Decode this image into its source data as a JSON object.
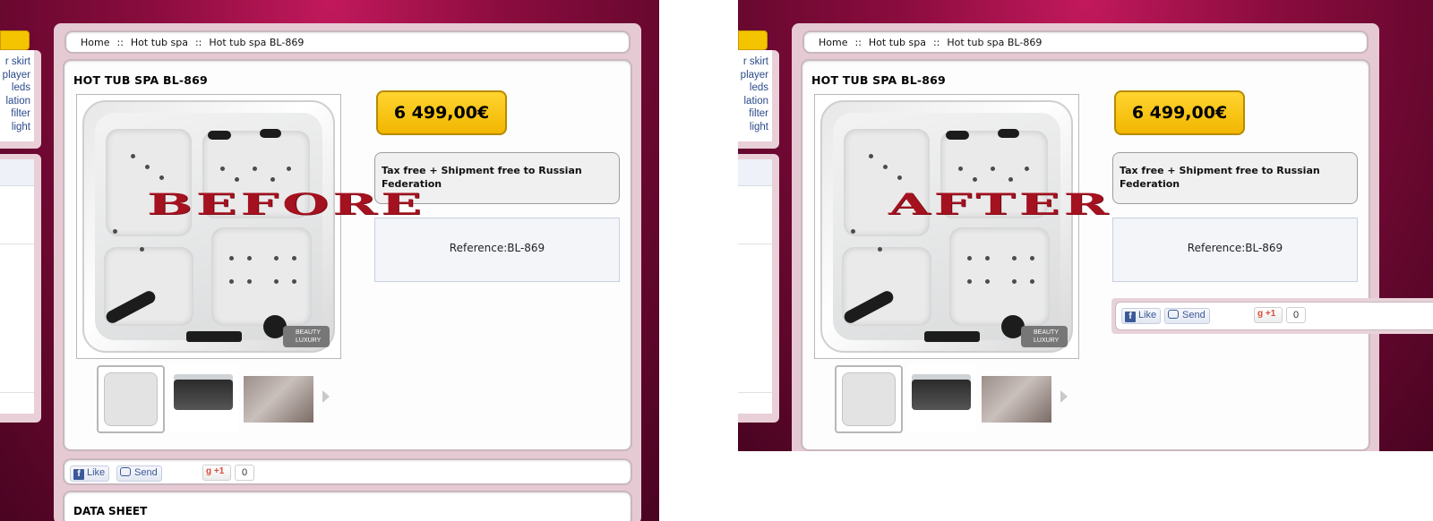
{
  "breadcrumb": {
    "home": "Home",
    "separator": "::",
    "category": "Hot tub spa",
    "current": "Hot tub spa BL-869"
  },
  "sidebar": {
    "links": [
      "r skirt",
      "player",
      "leds",
      "lation",
      "filter",
      "light"
    ]
  },
  "product": {
    "title": "HOT TUB SPA BL-869",
    "price": "6 499,00€",
    "tax_note": "Tax free + Shipment free to Russian Federation",
    "reference": "Reference:BL-869",
    "brand_badge": "BEAUTY LUXURY",
    "thumbnail_count": 3
  },
  "social": {
    "like_label": "Like",
    "send_label": "Send",
    "gplus_label": "+1",
    "gplus_count": "0"
  },
  "data_sheet": {
    "title": "DATA SHEET"
  },
  "labels": {
    "before": "BEFORE",
    "after": "AFTER"
  },
  "colors": {
    "background": "#8a0c3e",
    "price_badge": "#f5c400",
    "watermark": "#a4111f",
    "link": "#2b4a8a"
  }
}
